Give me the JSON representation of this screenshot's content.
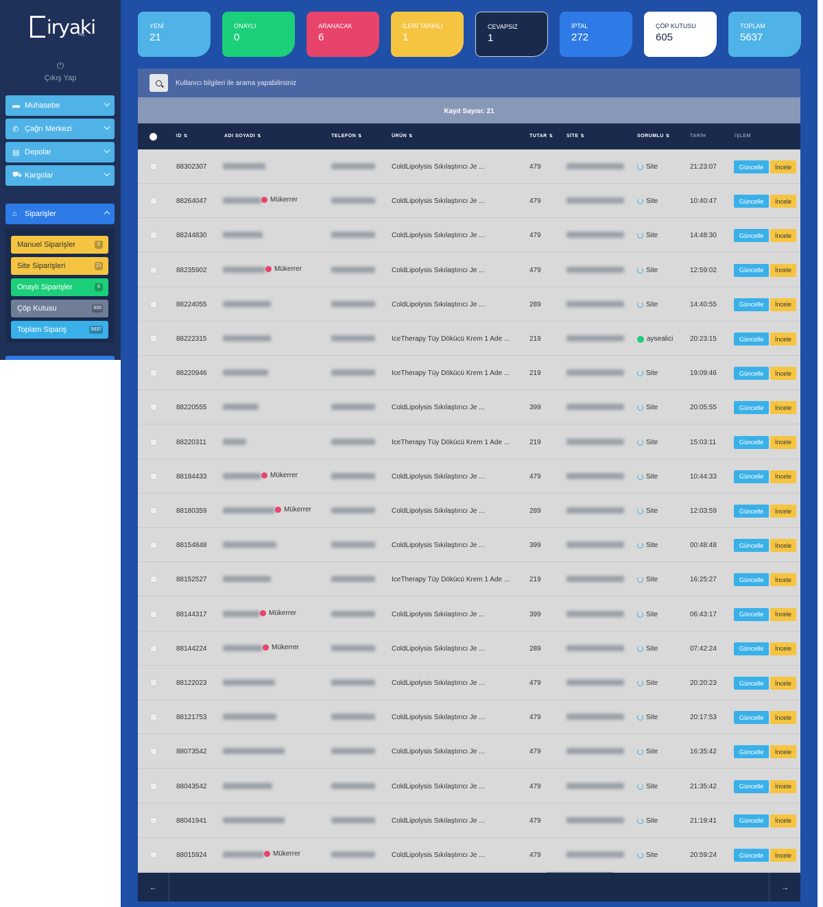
{
  "brand": {
    "name": "iryaki",
    "sub": "İlaç"
  },
  "sidebar": {
    "logout_label": "Çıkış Yap",
    "items": [
      {
        "label": "Muhasebe",
        "icon": "wallet-icon"
      },
      {
        "label": "Çağrı Merkezi",
        "icon": "phone-icon"
      },
      {
        "label": "Depolar",
        "icon": "warehouse-icon"
      },
      {
        "label": "Kargolar",
        "icon": "truck-icon"
      }
    ],
    "orders": {
      "label": "Siparişler",
      "icon": "basket-icon"
    },
    "sub_items": [
      {
        "label": "Manuel Siparişler",
        "badge": "0"
      },
      {
        "label": "Site Siparişleri",
        "badge": "21"
      },
      {
        "label": "Onaylı Siparişler",
        "badge": "0"
      },
      {
        "label": "Çöp Kutusu",
        "badge": "605"
      },
      {
        "label": "Toplam Sipariş",
        "badge": "5637"
      }
    ]
  },
  "stats": [
    {
      "label": "YENİ",
      "value": "21",
      "color": "#4fb3e8"
    },
    {
      "label": "ONAYLI",
      "value": "0",
      "color": "#1ccf7a"
    },
    {
      "label": "ARANACAK",
      "value": "6",
      "color": "#e8436b"
    },
    {
      "label": "İLERİ TARİHLİ",
      "value": "1",
      "color": "#f5c542"
    },
    {
      "label": "CEVAPSIZ",
      "value": "1",
      "color": "#1a2a4d"
    },
    {
      "label": "İPTAL",
      "value": "272",
      "color": "#2e7be8"
    },
    {
      "label": "ÇÖP KUTUSU",
      "value": "605",
      "color": "#ffffff"
    },
    {
      "label": "TOPLAM",
      "value": "5637",
      "color": "#4fb3e8"
    }
  ],
  "search": {
    "placeholder": "Kullanıcı bilgileri ile arama yapabilirsiniz"
  },
  "table": {
    "count_label": "Kayıt Sayısı: 21",
    "headers": [
      "ID",
      "ADI SOYADI",
      "TELEFON",
      "ÜRÜN",
      "TUTAR",
      "SİTE",
      "SORUMLU",
      "TARİH",
      "İŞLEM"
    ],
    "update_label": "Güncelle",
    "inspect_label": "İncele",
    "duplicate_label": "Mükerrer",
    "rows": [
      {
        "id": "88302307",
        "dup": false,
        "product": "ColdLipolysis Sıkılaştırıcı Je ...",
        "amount": "479",
        "owner": "Site",
        "owner_online": false,
        "time": "21:23:07"
      },
      {
        "id": "88264047",
        "dup": true,
        "product": "ColdLipolysis Sıkılaştırıcı Je ...",
        "amount": "479",
        "owner": "Site",
        "owner_online": false,
        "time": "10:40:47"
      },
      {
        "id": "88244830",
        "dup": false,
        "product": "ColdLipolysis Sıkılaştırıcı Je ...",
        "amount": "479",
        "owner": "Site",
        "owner_online": false,
        "time": "14:48:30"
      },
      {
        "id": "88235902",
        "dup": true,
        "product": "ColdLipolysis Sıkılaştırıcı Je ...",
        "amount": "479",
        "owner": "Site",
        "owner_online": false,
        "time": "12:59:02"
      },
      {
        "id": "88224055",
        "dup": false,
        "product": "ColdLipolysis Sıkılaştırıcı Je ...",
        "amount": "289",
        "owner": "Site",
        "owner_online": false,
        "time": "14:40:55"
      },
      {
        "id": "88222315",
        "dup": false,
        "product": "IceTherapy Tüy Dökücü Krem 1 Ade ...",
        "amount": "219",
        "owner": "aysealici",
        "owner_online": true,
        "time": "20:23:15"
      },
      {
        "id": "88220946",
        "dup": false,
        "product": "IceTherapy Tüy Dökücü Krem 1 Ade ...",
        "amount": "219",
        "owner": "Site",
        "owner_online": false,
        "time": "19:09:46"
      },
      {
        "id": "88220555",
        "dup": false,
        "product": "ColdLipolysis Sıkılaştırıcı Je ...",
        "amount": "399",
        "owner": "Site",
        "owner_online": false,
        "time": "20:05:55"
      },
      {
        "id": "88220311",
        "dup": false,
        "product": "IceTherapy Tüy Dökücü Krem 1 Ade ...",
        "amount": "219",
        "owner": "Site",
        "owner_online": false,
        "time": "15:03:11"
      },
      {
        "id": "88184433",
        "dup": true,
        "product": "ColdLipolysis Sıkılaştırıcı Je ...",
        "amount": "479",
        "owner": "Site",
        "owner_online": false,
        "time": "10:44:33"
      },
      {
        "id": "88180359",
        "dup": true,
        "product": "ColdLipolysis Sıkılaştırıcı Je ...",
        "amount": "289",
        "owner": "Site",
        "owner_online": false,
        "time": "12:03:59"
      },
      {
        "id": "88154848",
        "dup": false,
        "product": "ColdLipolysis Sıkılaştırıcı Je ...",
        "amount": "399",
        "owner": "Site",
        "owner_online": false,
        "time": "00:48:48"
      },
      {
        "id": "88152527",
        "dup": false,
        "product": "IceTherapy Tüy Dökücü Krem 1 Ade ...",
        "amount": "219",
        "owner": "Site",
        "owner_online": false,
        "time": "16:25:27"
      },
      {
        "id": "88144317",
        "dup": true,
        "product": "ColdLipolysis Sıkılaştırıcı Je ...",
        "amount": "399",
        "owner": "Site",
        "owner_online": false,
        "time": "06:43:17"
      },
      {
        "id": "88144224",
        "dup": true,
        "product": "ColdLipolysis Sıkılaştırıcı Je ...",
        "amount": "289",
        "owner": "Site",
        "owner_online": false,
        "time": "07:42:24"
      },
      {
        "id": "88122023",
        "dup": false,
        "product": "ColdLipolysis Sıkılaştırıcı Je ...",
        "amount": "479",
        "owner": "Site",
        "owner_online": false,
        "time": "20:20:23"
      },
      {
        "id": "88121753",
        "dup": false,
        "product": "ColdLipolysis Sıkılaştırıcı Je ...",
        "amount": "479",
        "owner": "Site",
        "owner_online": false,
        "time": "20:17:53"
      },
      {
        "id": "88073542",
        "dup": false,
        "product": "ColdLipolysis Sıkılaştırıcı Je ...",
        "amount": "479",
        "owner": "Site",
        "owner_online": false,
        "time": "16:35:42"
      },
      {
        "id": "88043542",
        "dup": false,
        "product": "ColdLipolysis Sıkılaştırıcı Je ...",
        "amount": "479",
        "owner": "Site",
        "owner_online": false,
        "time": "21:35:42"
      },
      {
        "id": "88041941",
        "dup": false,
        "product": "ColdLipolysis Sıkılaştırıcı Je ...",
        "amount": "479",
        "owner": "Site",
        "owner_online": false,
        "time": "21:19:41"
      },
      {
        "id": "88015924",
        "dup": true,
        "product": "ColdLipolysis Sıkılaştırıcı Je ...",
        "amount": "479",
        "owner": "Site",
        "owner_online": false,
        "time": "20:59:24"
      }
    ]
  },
  "pager": {
    "prev": "←",
    "next": "→"
  }
}
